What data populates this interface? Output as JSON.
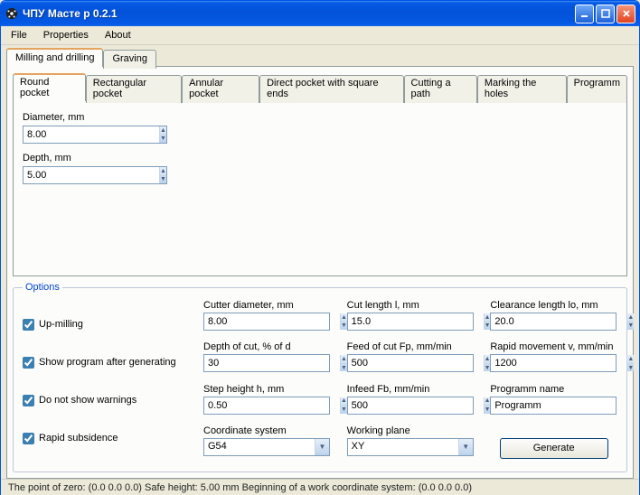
{
  "window": {
    "title": "ЧПУ Масте р 0.2.1"
  },
  "menu": {
    "file": "File",
    "properties": "Properties",
    "about": "About"
  },
  "top_tabs": {
    "milling": "Milling and drilling",
    "graving": "Graving"
  },
  "inner_tabs": {
    "round": "Round pocket",
    "rect": "Rectangular pocket",
    "annular": "Annular pocket",
    "direct": "Direct pocket with square ends",
    "path": "Cutting a path",
    "mark": "Marking the holes",
    "prog": "Programm"
  },
  "pocket": {
    "diameter_label": "Diameter, mm",
    "diameter_value": "8.00",
    "depth_label": "Depth, mm",
    "depth_value": "5.00"
  },
  "options_legend": "Options",
  "checks": {
    "up_milling": "Up-milling",
    "show_prog": "Show program after generating",
    "no_warn": "Do not show warnings",
    "rapid_sub": "Rapid subsidence"
  },
  "params": {
    "cutter_d_label": "Cutter diameter, mm",
    "cutter_d": "8.00",
    "cutlen_label": "Cut length l, mm",
    "cutlen": "15.0",
    "clearance_label": "Clearance length lo, mm",
    "clearance": "20.0",
    "doc_label": "Depth of cut, % of d",
    "doc": "30",
    "feedfp_label": "Feed of cut Fp, mm/min",
    "feedfp": "500",
    "rapidv_label": "Rapid movement v, mm/min",
    "rapidv": "1200",
    "steph_label": "Step height h, mm",
    "steph": "0.50",
    "infeed_label": "Infeed Fb, mm/min",
    "infeed": "500",
    "pname_label": "Programm name",
    "pname": "Programm",
    "coord_label": "Coordinate system",
    "coord": "G54",
    "plane_label": "Working plane",
    "plane": "XY"
  },
  "generate": "Generate",
  "status": "The point of zero: (0.0  0.0  0.0)     Safe height: 5.00 mm    Beginning of a work coordinate system: (0.0  0.0  0.0)"
}
